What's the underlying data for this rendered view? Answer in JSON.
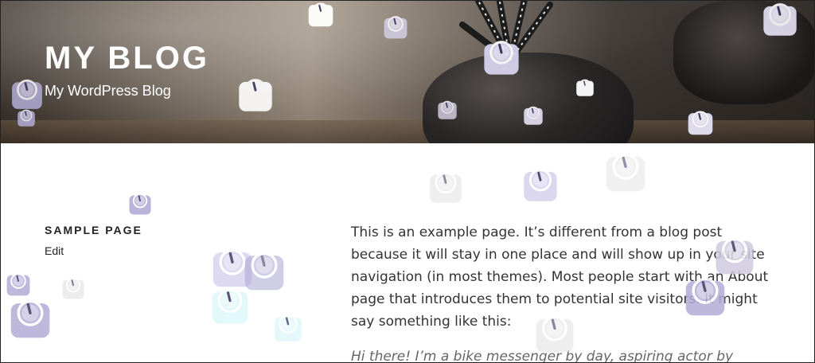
{
  "header": {
    "site_title": "MY BLOG",
    "site_description": "My WordPress Blog"
  },
  "sidebar": {
    "page_title": "SAMPLE PAGE",
    "edit_label": "Edit"
  },
  "main": {
    "paragraph": "This is an example page. It’s different from a blog post because it will stay in one place and will show up in your site navigation (in most themes). Most people start with an About page that introduces them to potential site visitors. It might say something like this:",
    "quote": "Hi there! I’m a bike messenger by day, aspiring actor by"
  },
  "overlay": {
    "icon": "scale-icon",
    "colors": [
      "#d7d3ee",
      "#b2acd6",
      "#ffffff",
      "#cfcbe0",
      "#e6e3f6",
      "#dff7fa",
      "#e4e4e4"
    ]
  }
}
